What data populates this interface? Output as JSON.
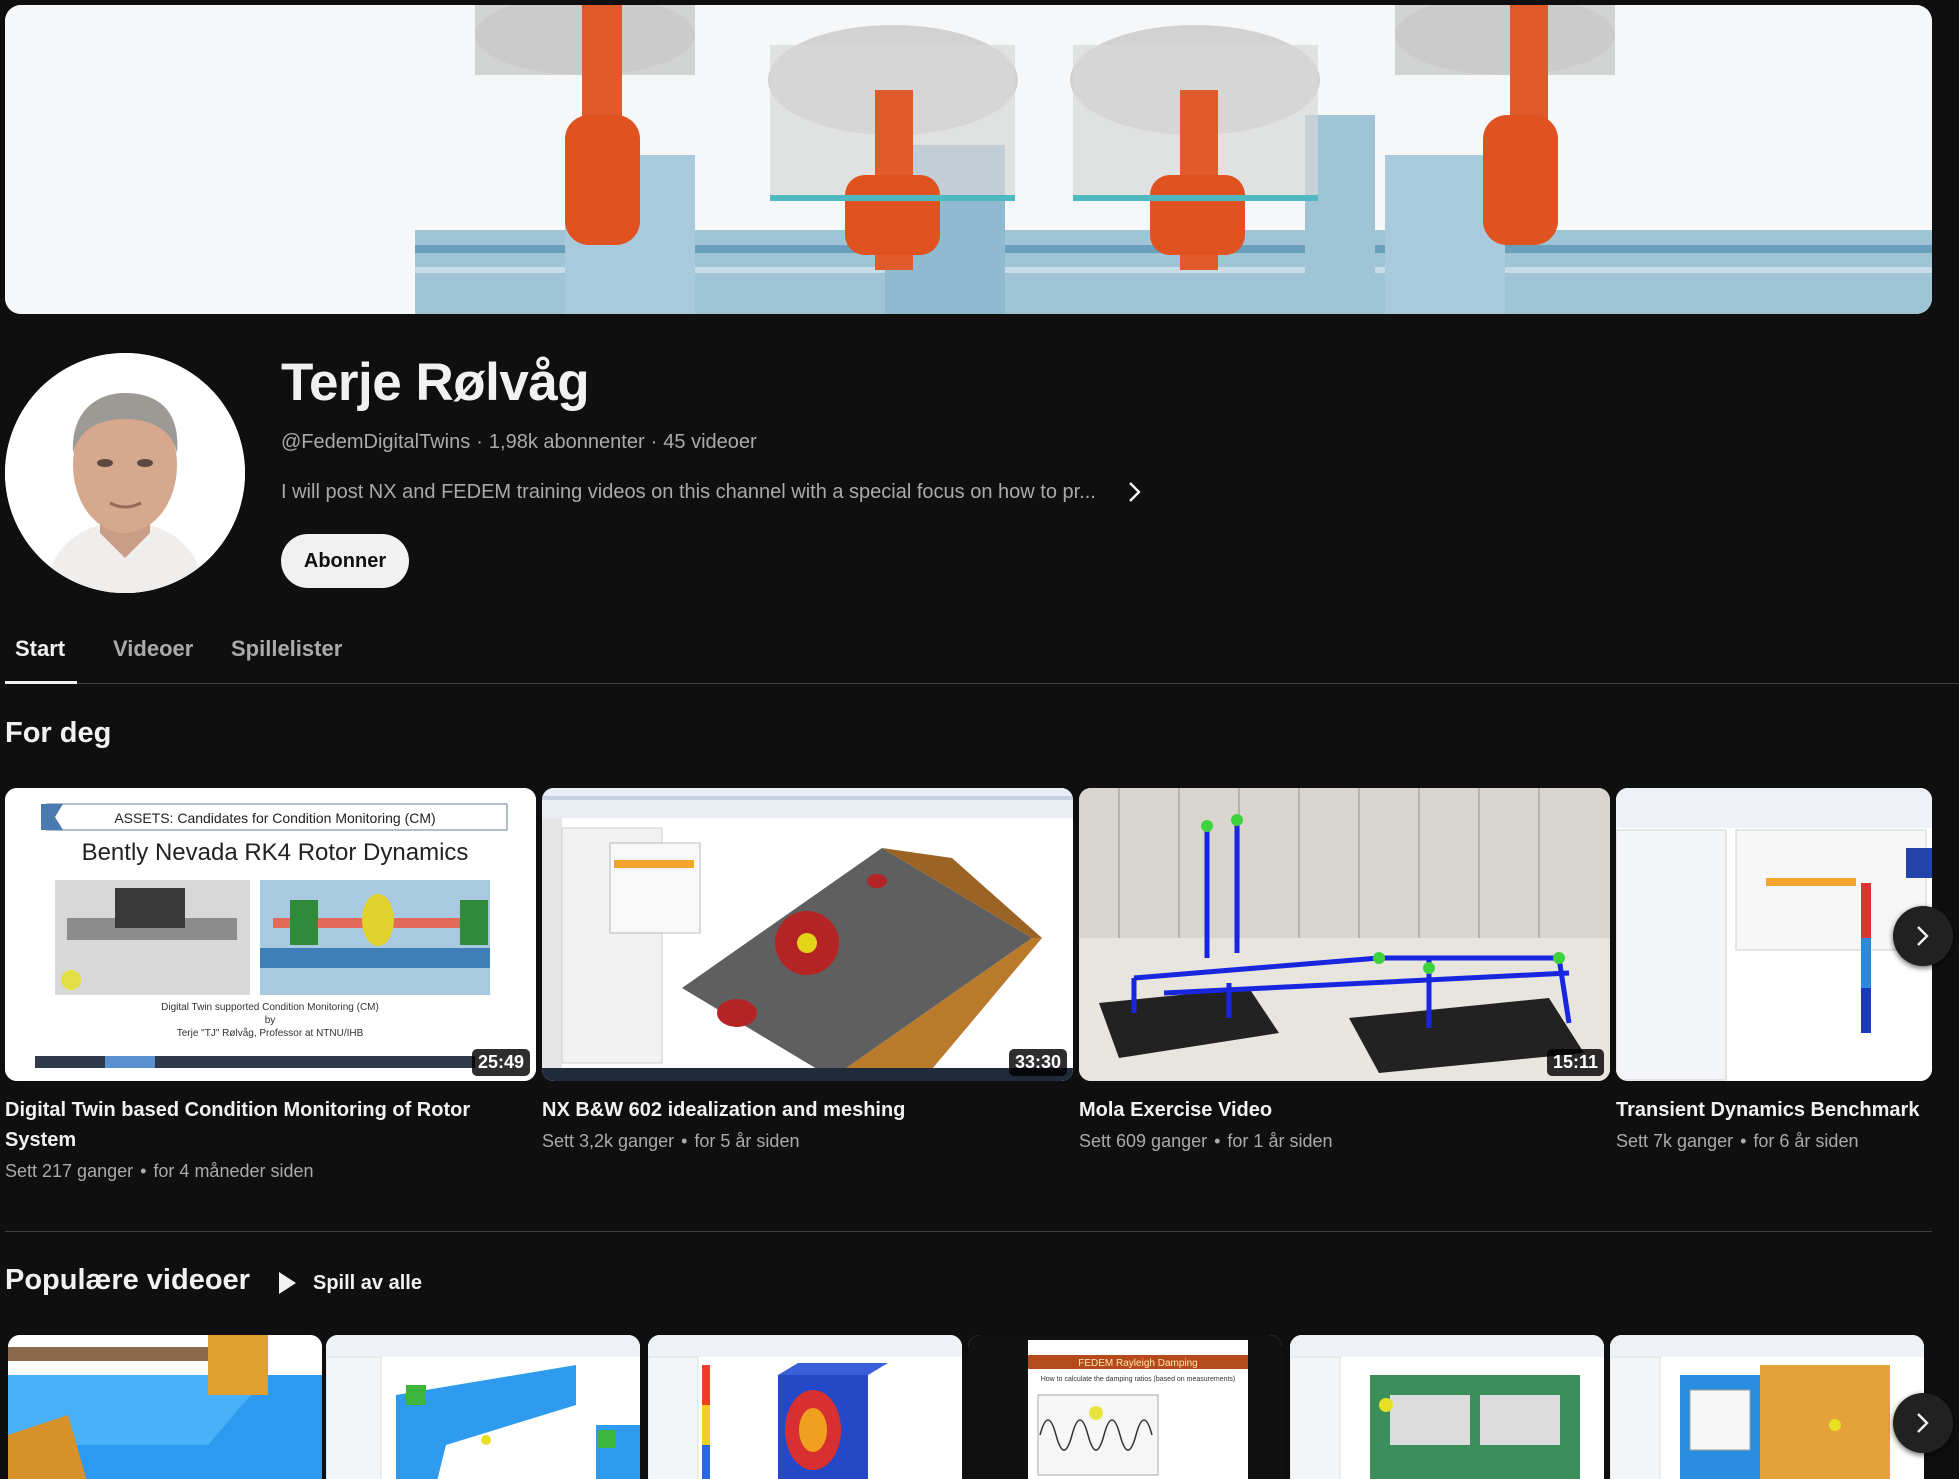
{
  "channel": {
    "name": "Terje Rølvåg",
    "handle": "@FedemDigitalTwins",
    "subscribers": "1,98k abonnenter",
    "video_count": "45 videoer",
    "separator": "·",
    "description": "I will post NX and FEDEM training videos on this channel with a special focus on how to pr...",
    "subscribe_label": "Abonner"
  },
  "tabs": [
    {
      "label": "Start",
      "active": true
    },
    {
      "label": "Videoer",
      "active": false
    },
    {
      "label": "Spillelister",
      "active": false
    }
  ],
  "for_you": {
    "title": "For deg",
    "videos": [
      {
        "title": "Digital Twin based Condition Monitoring of Rotor System",
        "duration": "25:49",
        "views": "Sett 217 ganger",
        "age": "for 4 måneder siden"
      },
      {
        "title": "NX B&W 602 idealization and meshing",
        "duration": "33:30",
        "views": "Sett 3,2k ganger",
        "age": "for 5 år siden"
      },
      {
        "title": "Mola Exercise Video",
        "duration": "15:11",
        "views": "Sett 609 ganger",
        "age": "for 1 år siden"
      },
      {
        "title": "Transient Dynamics Benchmark",
        "duration": "",
        "views": "Sett 7k ganger",
        "age": "for 6 år siden"
      }
    ],
    "thumb1_texts": {
      "assets": "ASSETS: Candidates for Condition Monitoring (CM)",
      "heading": "Bently Nevada RK4 Rotor Dynamics",
      "line1": "Digital Twin supported Condition Monitoring (CM)",
      "line2": "by",
      "line3": "Terje \"TJ\" Rølvåg, Professor at NTNU/IHB"
    }
  },
  "popular": {
    "title": "Populære videoer",
    "play_all_label": "Spill av alle",
    "thumb4_texts": {
      "heading": "FEDEM Rayleigh Damping",
      "sub": "How to calculate the damping ratios (based on measurements)"
    }
  },
  "meta_separator": "•",
  "icons": {
    "next": "chevron-right-icon",
    "expand_description": "chevron-right-icon",
    "play_all": "play-icon"
  },
  "colors": {
    "background": "#0f0f0f",
    "text_primary": "#f1f1f1",
    "text_secondary": "#aaaaaa",
    "subscribe_bg": "#f1f1f1",
    "divider": "#3f3f3f"
  }
}
